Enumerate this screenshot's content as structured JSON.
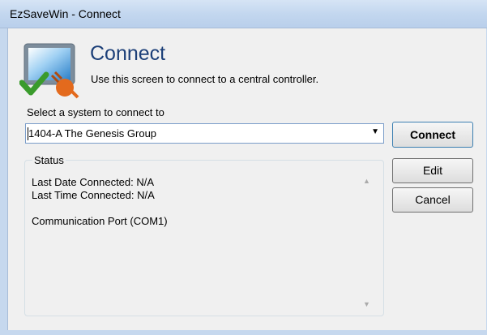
{
  "window": {
    "title": "EzSaveWin - Connect"
  },
  "header": {
    "heading": "Connect",
    "subheading": "Use this screen to connect to a central controller.",
    "icon": "monitor-check-plug-icon"
  },
  "system": {
    "label": "Select a system to connect to",
    "selected": "1404-A The Genesis Group"
  },
  "buttons": {
    "connect": "Connect",
    "edit": "Edit",
    "cancel": "Cancel"
  },
  "status": {
    "legend": "Status",
    "last_date": "Last Date Connected: N/A",
    "last_time": "Last Time Connected: N/A",
    "port": "Communication Port (COM1)"
  },
  "colors": {
    "heading": "#1c3f78",
    "titlebar": "#c3d7ef",
    "connect_border": "#3c7fb1"
  }
}
